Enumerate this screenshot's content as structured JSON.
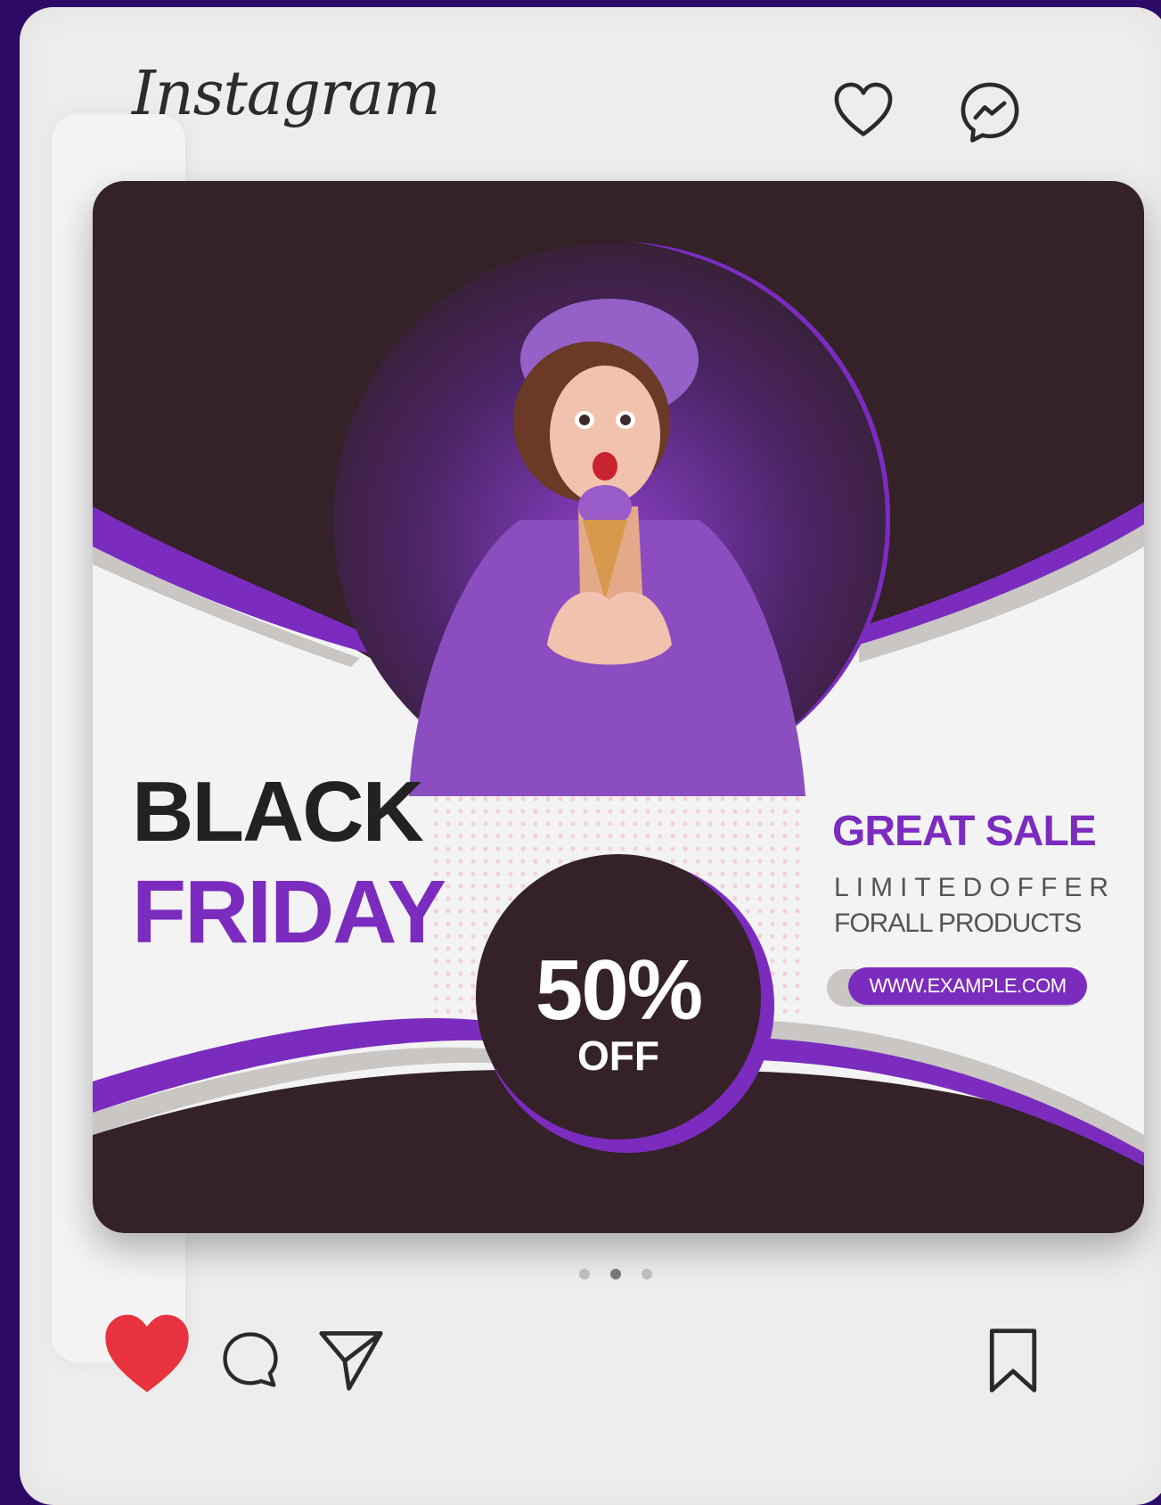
{
  "app": {
    "brand": "Instagram"
  },
  "header_icons": [
    "heart-outline-icon",
    "messenger-icon"
  ],
  "post": {
    "headline_line1": "BLACK",
    "headline_line2": "FRIDAY",
    "promo_title": "GREAT SALE",
    "promo_line1": "LIMITEDOFFER",
    "promo_line2": "FORALL PRODUCTS",
    "website": "WWW.EXAMPLE.COM",
    "discount_value": "50%",
    "discount_label": "OFF",
    "colors": {
      "accent_purple": "#7b2cbf",
      "dark_plum": "#342228",
      "light_bg": "#f3f3f3"
    }
  },
  "carousel": {
    "count": 3,
    "active_index": 1
  },
  "actions": {
    "like_state": "liked",
    "icons": [
      "heart-filled-icon",
      "comment-icon",
      "share-send-icon",
      "bookmark-icon"
    ],
    "like_color": "#e8323f"
  }
}
